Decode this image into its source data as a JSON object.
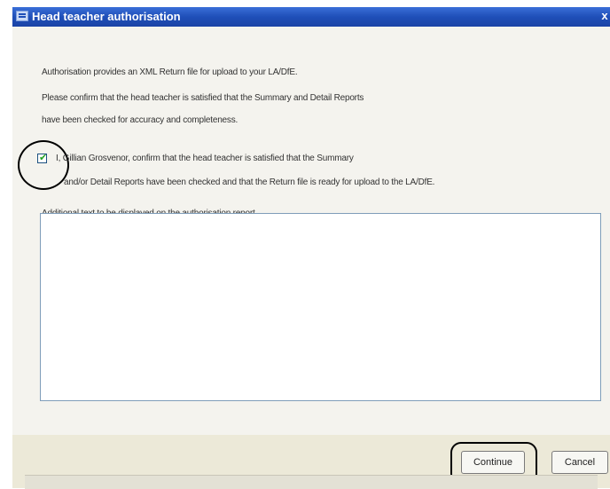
{
  "window": {
    "title": "Head teacher authorisation",
    "close_glyph": "x"
  },
  "content": {
    "intro_line": "Authorisation provides an XML Return file for upload to your LA/DfE.",
    "confirm_line1": "Please confirm that the head teacher is satisfied that the Summary and Detail Reports",
    "confirm_line2": "have been checked for accuracy and completeness.",
    "checkbox_checked": true,
    "checkbox_label_line1": "I, Gillian Grosvenor, confirm that the head teacher is satisfied that the Summary",
    "checkbox_label_line2": "and/or Detail Reports have been checked and that the Return file is ready for upload to the LA/DfE.",
    "additional_text_label": "Additional text to be displayed on the authorisation report",
    "additional_text_value": ""
  },
  "buttons": {
    "continue_label": "Continue",
    "cancel_label": "Cancel"
  },
  "icons": {
    "title_icon": "window-app-icon",
    "check_glyph": "✔"
  },
  "colors": {
    "titlebar": "#1f4fb8",
    "check_green": "#21a121",
    "highlight_outline": "#000000"
  }
}
